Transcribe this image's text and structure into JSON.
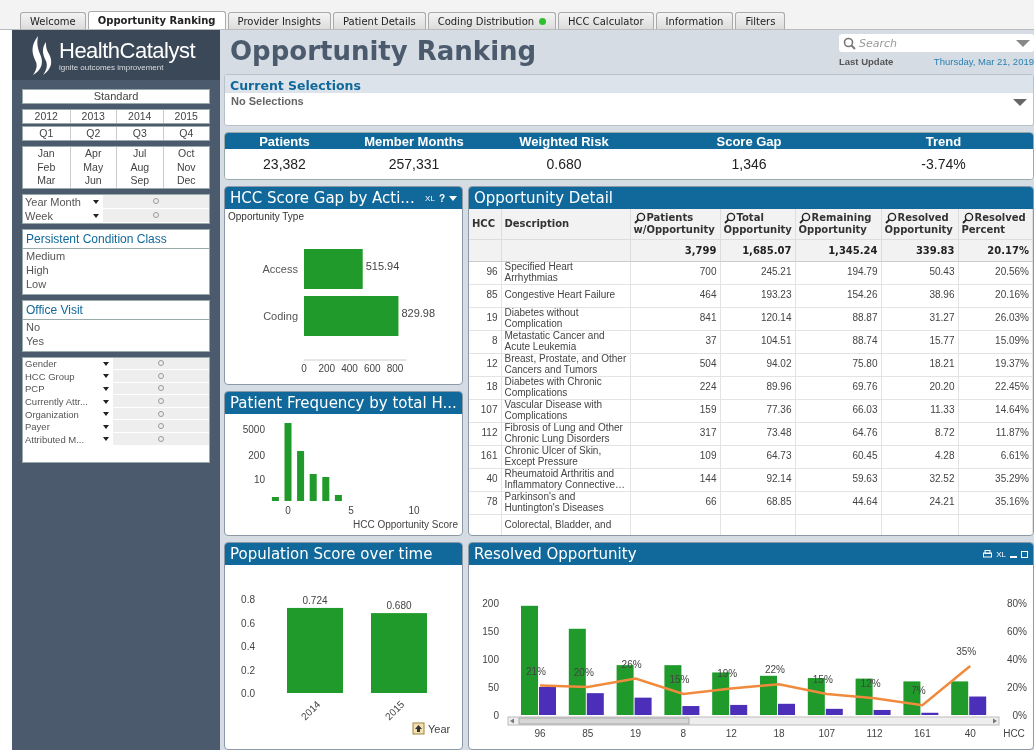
{
  "tabs": [
    {
      "label": "Welcome",
      "selected": false,
      "dot": false
    },
    {
      "label": "Opportunity Ranking",
      "selected": true,
      "dot": false
    },
    {
      "label": "Provider Insights",
      "selected": false,
      "dot": false
    },
    {
      "label": "Patient Details",
      "selected": false,
      "dot": false
    },
    {
      "label": "Coding Distribution",
      "selected": false,
      "dot": true
    },
    {
      "label": "HCC Calculator",
      "selected": false,
      "dot": false
    },
    {
      "label": "Information",
      "selected": false,
      "dot": false
    },
    {
      "label": "Filters",
      "selected": false,
      "dot": false
    }
  ],
  "sidebar": {
    "logo": {
      "name": "HealthCatalyst",
      "tagline": "ignite outcomes improvement"
    },
    "calendar": {
      "mode": "Standard",
      "years": [
        "2012",
        "2013",
        "2014",
        "2015"
      ],
      "quarters": [
        "Q1",
        "Q2",
        "Q3",
        "Q4"
      ],
      "months": [
        "Jan",
        "Apr",
        "Jul",
        "Oct",
        "Feb",
        "May",
        "Aug",
        "Nov",
        "Mar",
        "Jun",
        "Sep",
        "Dec"
      ]
    },
    "period_fields": [
      "Year Month",
      "Week"
    ],
    "listboxes": [
      {
        "title": "Persistent Condition Class",
        "items": [
          "Medium",
          "High",
          "Low"
        ]
      },
      {
        "title": "Office Visit",
        "items": [
          "No",
          "Yes"
        ]
      }
    ],
    "filter_fields": [
      "Gender",
      "HCC Group",
      "PCP",
      "Currently Attr...",
      "Organization",
      "Payer",
      "Attributed M..."
    ]
  },
  "header": {
    "title": "Opportunity Ranking",
    "search": {
      "placeholder": "Search"
    },
    "last_update_label": "Last Update",
    "last_update": "Thursday, Mar 21, 2019"
  },
  "current_selections": {
    "title": "Current Selections",
    "text": "No Selections"
  },
  "kpis": [
    {
      "label": "Patients",
      "value": "23,382"
    },
    {
      "label": "Member Months",
      "value": "257,331"
    },
    {
      "label": "Weighted Risk",
      "value": "0.680"
    },
    {
      "label": "Score Gap",
      "value": "1,346"
    },
    {
      "label": "Trend",
      "value": "-3.74%"
    }
  ],
  "score_gap": {
    "title": "HCC Score Gap by Acti...",
    "tools": [
      "XL",
      "?"
    ],
    "subtitle": "Opportunity Type",
    "chart_data": {
      "type": "bar",
      "orientation": "horizontal",
      "categories": [
        "Access",
        "Coding"
      ],
      "series": [
        {
          "color": "#209a2a",
          "values": [
            515.94,
            829.98
          ]
        }
      ],
      "xlim": [
        0,
        900
      ],
      "xticks": [
        0,
        200,
        400,
        600,
        800
      ],
      "data_labels": true
    }
  },
  "frequency": {
    "title": "Patient Frequency by total H...",
    "y_labels": [
      "5000",
      "200",
      "10"
    ],
    "x_labels": [
      "0",
      "5",
      "10"
    ],
    "xlabel": "HCC Opportunity Score"
  },
  "population": {
    "title": "Population Score over time",
    "chart_data": {
      "type": "bar",
      "xlabel": "Year",
      "categories": [
        "2014",
        "2015"
      ],
      "series": [
        {
          "color": "#209a2a",
          "values": [
            0.724,
            0.68
          ]
        }
      ],
      "ylim": [
        0,
        0.8
      ],
      "yticks": [
        {
          "value": 0,
          "label": "0.0"
        },
        {
          "value": 0.2,
          "label": "0.2"
        },
        {
          "value": 0.4,
          "label": "0.4"
        },
        {
          "value": 0.6,
          "label": "0.6"
        },
        {
          "value": 0.8,
          "label": "0.8"
        }
      ],
      "value_labels": [
        "0.724",
        "0.680"
      ]
    }
  },
  "detail": {
    "title": "Opportunity Detail",
    "columns": [
      {
        "label": "HCC",
        "searchable": false
      },
      {
        "label": "Description",
        "searchable": false
      },
      {
        "label": "Patients w/Opportunity",
        "searchable": true
      },
      {
        "label": "Total Opportunity",
        "searchable": true
      },
      {
        "label": "Remaining Opportunity",
        "searchable": true
      },
      {
        "label": "Resolved Opportunity",
        "searchable": true
      },
      {
        "label": "Resolved Percent",
        "searchable": true
      }
    ],
    "totals": [
      "3,799",
      "1,685.07",
      "1,345.24",
      "339.83",
      "20.17%"
    ],
    "rows": [
      {
        "hcc": "96",
        "description": "Specified Heart Arrhythmias",
        "values": [
          "700",
          "245.21",
          "194.79",
          "50.43",
          "20.56%"
        ]
      },
      {
        "hcc": "85",
        "description": "Congestive Heart Failure",
        "values": [
          "464",
          "193.23",
          "154.26",
          "38.96",
          "20.16%"
        ]
      },
      {
        "hcc": "19",
        "description": "Diabetes without Complication",
        "values": [
          "841",
          "120.14",
          "88.87",
          "31.27",
          "26.03%"
        ]
      },
      {
        "hcc": "8",
        "description": "Metastatic Cancer and Acute Leukemia",
        "values": [
          "37",
          "104.51",
          "88.74",
          "15.77",
          "15.09%"
        ]
      },
      {
        "hcc": "12",
        "description": "Breast, Prostate, and Other Cancers and Tumors",
        "values": [
          "504",
          "94.02",
          "75.80",
          "18.21",
          "19.37%"
        ]
      },
      {
        "hcc": "18",
        "description": "Diabetes with Chronic Complications",
        "values": [
          "224",
          "89.96",
          "69.76",
          "20.20",
          "22.45%"
        ]
      },
      {
        "hcc": "107",
        "description": "Vascular Disease with Complications",
        "values": [
          "159",
          "77.36",
          "66.03",
          "11.33",
          "14.64%"
        ]
      },
      {
        "hcc": "112",
        "description": "Fibrosis of Lung and Other Chronic Lung Disorders",
        "values": [
          "317",
          "73.48",
          "64.76",
          "8.72",
          "11.87%"
        ]
      },
      {
        "hcc": "161",
        "description": "Chronic Ulcer of Skin, Except Pressure",
        "values": [
          "109",
          "64.73",
          "60.45",
          "4.28",
          "6.61%"
        ]
      },
      {
        "hcc": "40",
        "description": "Rheumatoid Arthritis and Inflammatory Connective…",
        "values": [
          "144",
          "92.14",
          "59.63",
          "32.52",
          "35.29%"
        ]
      },
      {
        "hcc": "78",
        "description": "Parkinson's and Huntington's Diseases",
        "values": [
          "66",
          "68.85",
          "44.64",
          "24.21",
          "35.16%"
        ]
      },
      {
        "description": "Colorectal, Bladder, and"
      }
    ]
  },
  "resolved": {
    "title": "Resolved Opportunity",
    "tools": [
      "XL"
    ],
    "chart_data": {
      "type": "bar",
      "xlabel": "HCC",
      "categories": [
        "96",
        "85",
        "19",
        "8",
        "12",
        "18",
        "107",
        "112",
        "161",
        "40"
      ],
      "series": [
        {
          "type": "bar",
          "color": "#209a2a",
          "values": [
            195,
            154,
            89,
            89,
            76,
            70,
            66,
            65,
            60,
            60
          ]
        },
        {
          "type": "bar",
          "color": "#4b2fb8",
          "values": [
            50,
            39,
            31,
            16,
            18,
            20,
            11,
            9,
            4,
            33
          ]
        },
        {
          "type": "line",
          "axis": "y2",
          "color": "#f08a3c",
          "values": [
            0.21,
            0.2,
            0.26,
            0.15,
            0.19,
            0.22,
            0.15,
            0.12,
            0.07,
            0.35
          ]
        }
      ],
      "ylim": [
        0,
        200
      ],
      "yticks": [
        0,
        50,
        100,
        150,
        200
      ],
      "y2lim": [
        0,
        0.8
      ],
      "y2ticks": [
        {
          "value": 0,
          "label": "0%"
        },
        {
          "value": 0.2,
          "label": "20%"
        },
        {
          "value": 0.4,
          "label": "40%"
        },
        {
          "value": 0.6,
          "label": "60%"
        },
        {
          "value": 0.8,
          "label": "80%"
        }
      ],
      "value_labels": [
        "21%",
        "20%",
        "26%",
        "15%",
        "19%",
        "22%",
        "15%",
        "12%",
        "7%",
        "35%"
      ]
    }
  }
}
